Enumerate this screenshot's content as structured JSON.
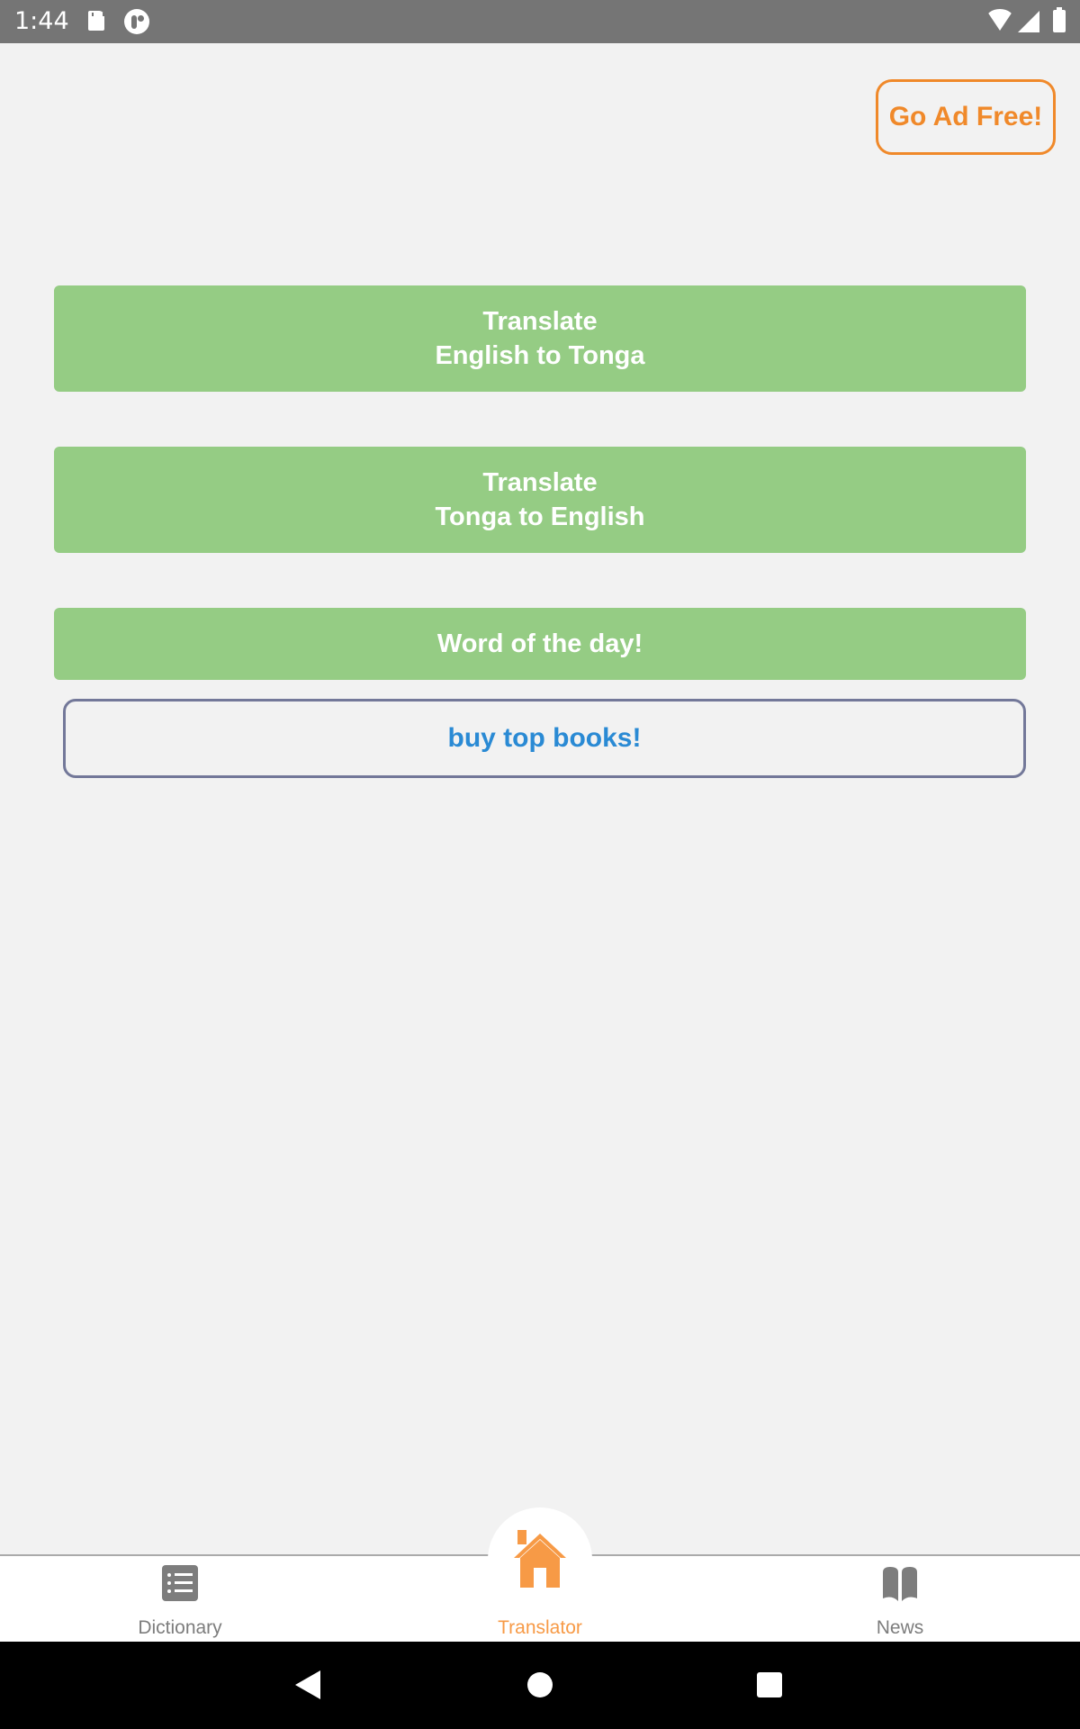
{
  "status_bar": {
    "time": "1:44"
  },
  "header": {
    "ad_free_label": "Go Ad Free!"
  },
  "main": {
    "buttons": [
      {
        "line1": "Translate",
        "line2": "English to Tonga"
      },
      {
        "line1": "Translate",
        "line2": "Tonga to English"
      },
      {
        "line1": "Word of the day!"
      }
    ],
    "books_label": "buy top books!"
  },
  "colors": {
    "accent": "#f79a46",
    "green": "#95cc84",
    "link_blue": "#2a8ad4",
    "ad_orange": "#f0892a"
  },
  "tabbar": {
    "tabs": [
      {
        "label": "Dictionary",
        "icon": "list-icon",
        "active": false
      },
      {
        "label": "Translator",
        "icon": "home-icon",
        "active": true
      },
      {
        "label": "News",
        "icon": "book-open-icon",
        "active": false
      }
    ]
  }
}
